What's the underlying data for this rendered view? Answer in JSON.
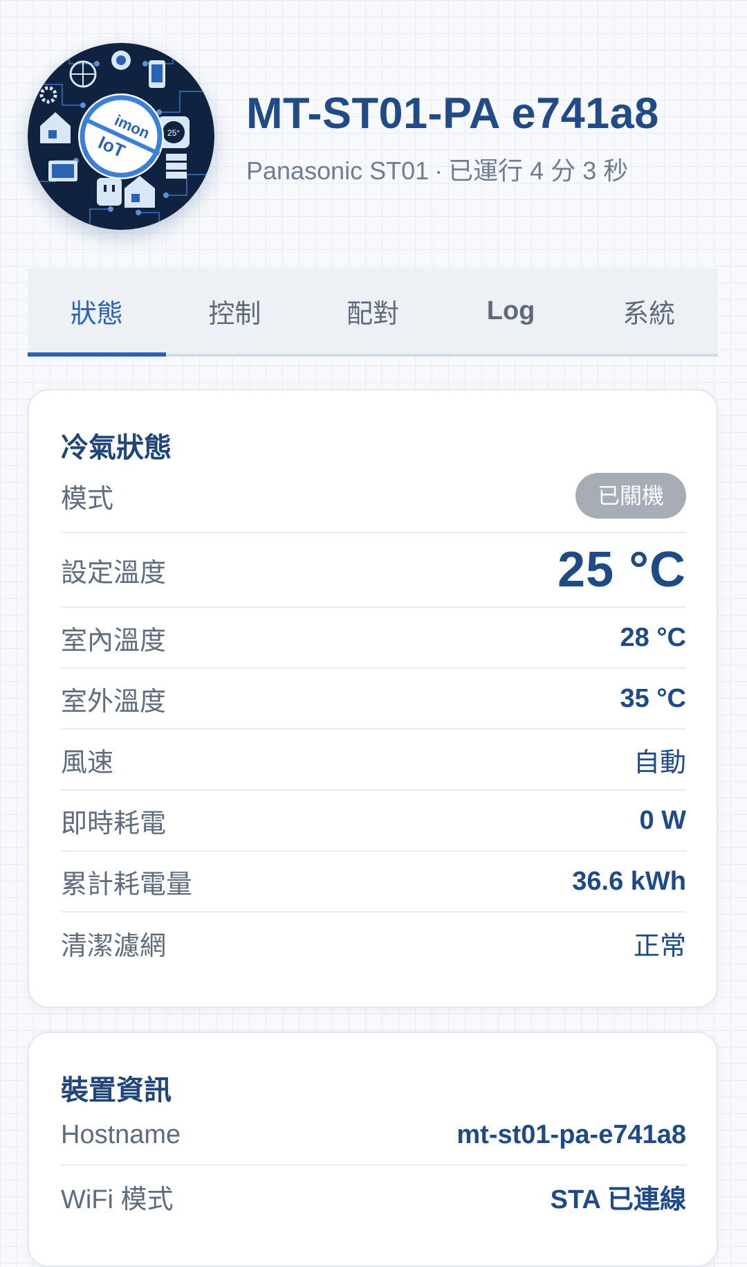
{
  "header": {
    "title": "MT-ST01-PA e741a8",
    "model": "Panasonic ST01",
    "separator": "·",
    "uptime": "已運行 4 分 3 秒",
    "logo": {
      "brand_top": "imon",
      "brand_bottom": "IoT",
      "thermostat_reading": "25°"
    }
  },
  "tabs": [
    {
      "label": "狀態",
      "active": true
    },
    {
      "label": "控制",
      "active": false
    },
    {
      "label": "配對",
      "active": false
    },
    {
      "label": "Log",
      "active": false
    },
    {
      "label": "系統",
      "active": false
    }
  ],
  "ac_status": {
    "title": "冷氣狀態",
    "rows": [
      {
        "label": "模式",
        "value": "已關機"
      },
      {
        "label": "設定溫度",
        "value": "25 °C"
      },
      {
        "label": "室內溫度",
        "value": "28 °C"
      },
      {
        "label": "室外溫度",
        "value": "35 °C"
      },
      {
        "label": "風速",
        "value": "自動"
      },
      {
        "label": "即時耗電",
        "value": "0 W"
      },
      {
        "label": "累計耗電量",
        "value": "36.6 kWh"
      },
      {
        "label": "清潔濾網",
        "value": "正常"
      }
    ]
  },
  "device_info": {
    "title": "裝置資訊",
    "rows": [
      {
        "label": "Hostname",
        "value": "mt-st01-pa-e741a8"
      },
      {
        "label": "WiFi 模式",
        "value": "STA 已連線"
      }
    ]
  },
  "colors": {
    "accent": "#2a62b4",
    "title": "#204b86",
    "badge_off": "#a6adb7",
    "logo_bg": "#0f2340"
  }
}
